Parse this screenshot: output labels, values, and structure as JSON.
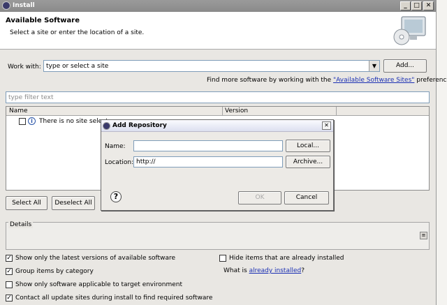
{
  "window": {
    "title": "Install"
  },
  "banner": {
    "heading": "Available Software",
    "description": "Select a site or enter the location of a site."
  },
  "work_with": {
    "label": "Work with:",
    "value": "type or select a site",
    "add_button": "Add..."
  },
  "find_more": {
    "prefix": "Find more software by working with the ",
    "link": "\"Available Software Sites\"",
    "suffix": " preferences."
  },
  "filter": {
    "placeholder": "type filter text"
  },
  "table": {
    "columns": [
      "Name",
      "Version"
    ],
    "rows": [
      {
        "name": "There is no site select"
      }
    ]
  },
  "buttons": {
    "select_all": "Select All",
    "deselect_all": "Deselect All"
  },
  "details": {
    "label": "Details"
  },
  "options": {
    "latest_versions": {
      "label": "Show only the latest versions of available software",
      "checked": true
    },
    "group_by_category": {
      "label": "Group items by category",
      "checked": true
    },
    "target_env": {
      "label": "Show only software applicable to target environment",
      "checked": false
    },
    "contact_sites": {
      "label": "Contact all update sites during install to find required software",
      "checked": true
    },
    "hide_installed": {
      "label": "Hide items that are already installed",
      "checked": false
    }
  },
  "what_is": {
    "prefix": "What is ",
    "link": "already installed",
    "suffix": "?"
  },
  "dialog": {
    "title": "Add Repository",
    "name_label": "Name:",
    "name_value": "",
    "location_label": "Location:",
    "location_value": "http://",
    "local_button": "Local...",
    "archive_button": "Archive...",
    "ok_button": "OK",
    "cancel_button": "Cancel",
    "close_glyph": "✕",
    "help_glyph": "?"
  }
}
